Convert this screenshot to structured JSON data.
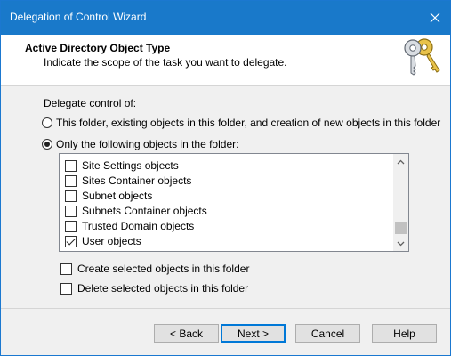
{
  "window": {
    "title": "Delegation of Control Wizard",
    "accent_color": "#1979ca"
  },
  "header": {
    "title": "Active Directory Object Type",
    "subtitle": "Indicate the scope of the task you want to delegate.",
    "icon": "keys-icon"
  },
  "scope": {
    "label": "Delegate control of:",
    "options": [
      {
        "label": "This folder, existing objects in this folder, and creation of new objects in this folder",
        "selected": false
      },
      {
        "label": "Only the following objects in the folder:",
        "selected": true
      }
    ]
  },
  "object_list": {
    "items": [
      {
        "label": "Site Settings objects",
        "checked": false
      },
      {
        "label": "Sites Container objects",
        "checked": false
      },
      {
        "label": "Subnet objects",
        "checked": false
      },
      {
        "label": "Subnets Container objects",
        "checked": false
      },
      {
        "label": "Trusted Domain objects",
        "checked": false
      },
      {
        "label": "User objects",
        "checked": true
      }
    ]
  },
  "options": {
    "create_label": "Create selected objects in this folder",
    "create_checked": false,
    "delete_label": "Delete selected objects in this folder",
    "delete_checked": false
  },
  "buttons": {
    "back": "< Back",
    "next": "Next >",
    "cancel": "Cancel",
    "help": "Help"
  }
}
